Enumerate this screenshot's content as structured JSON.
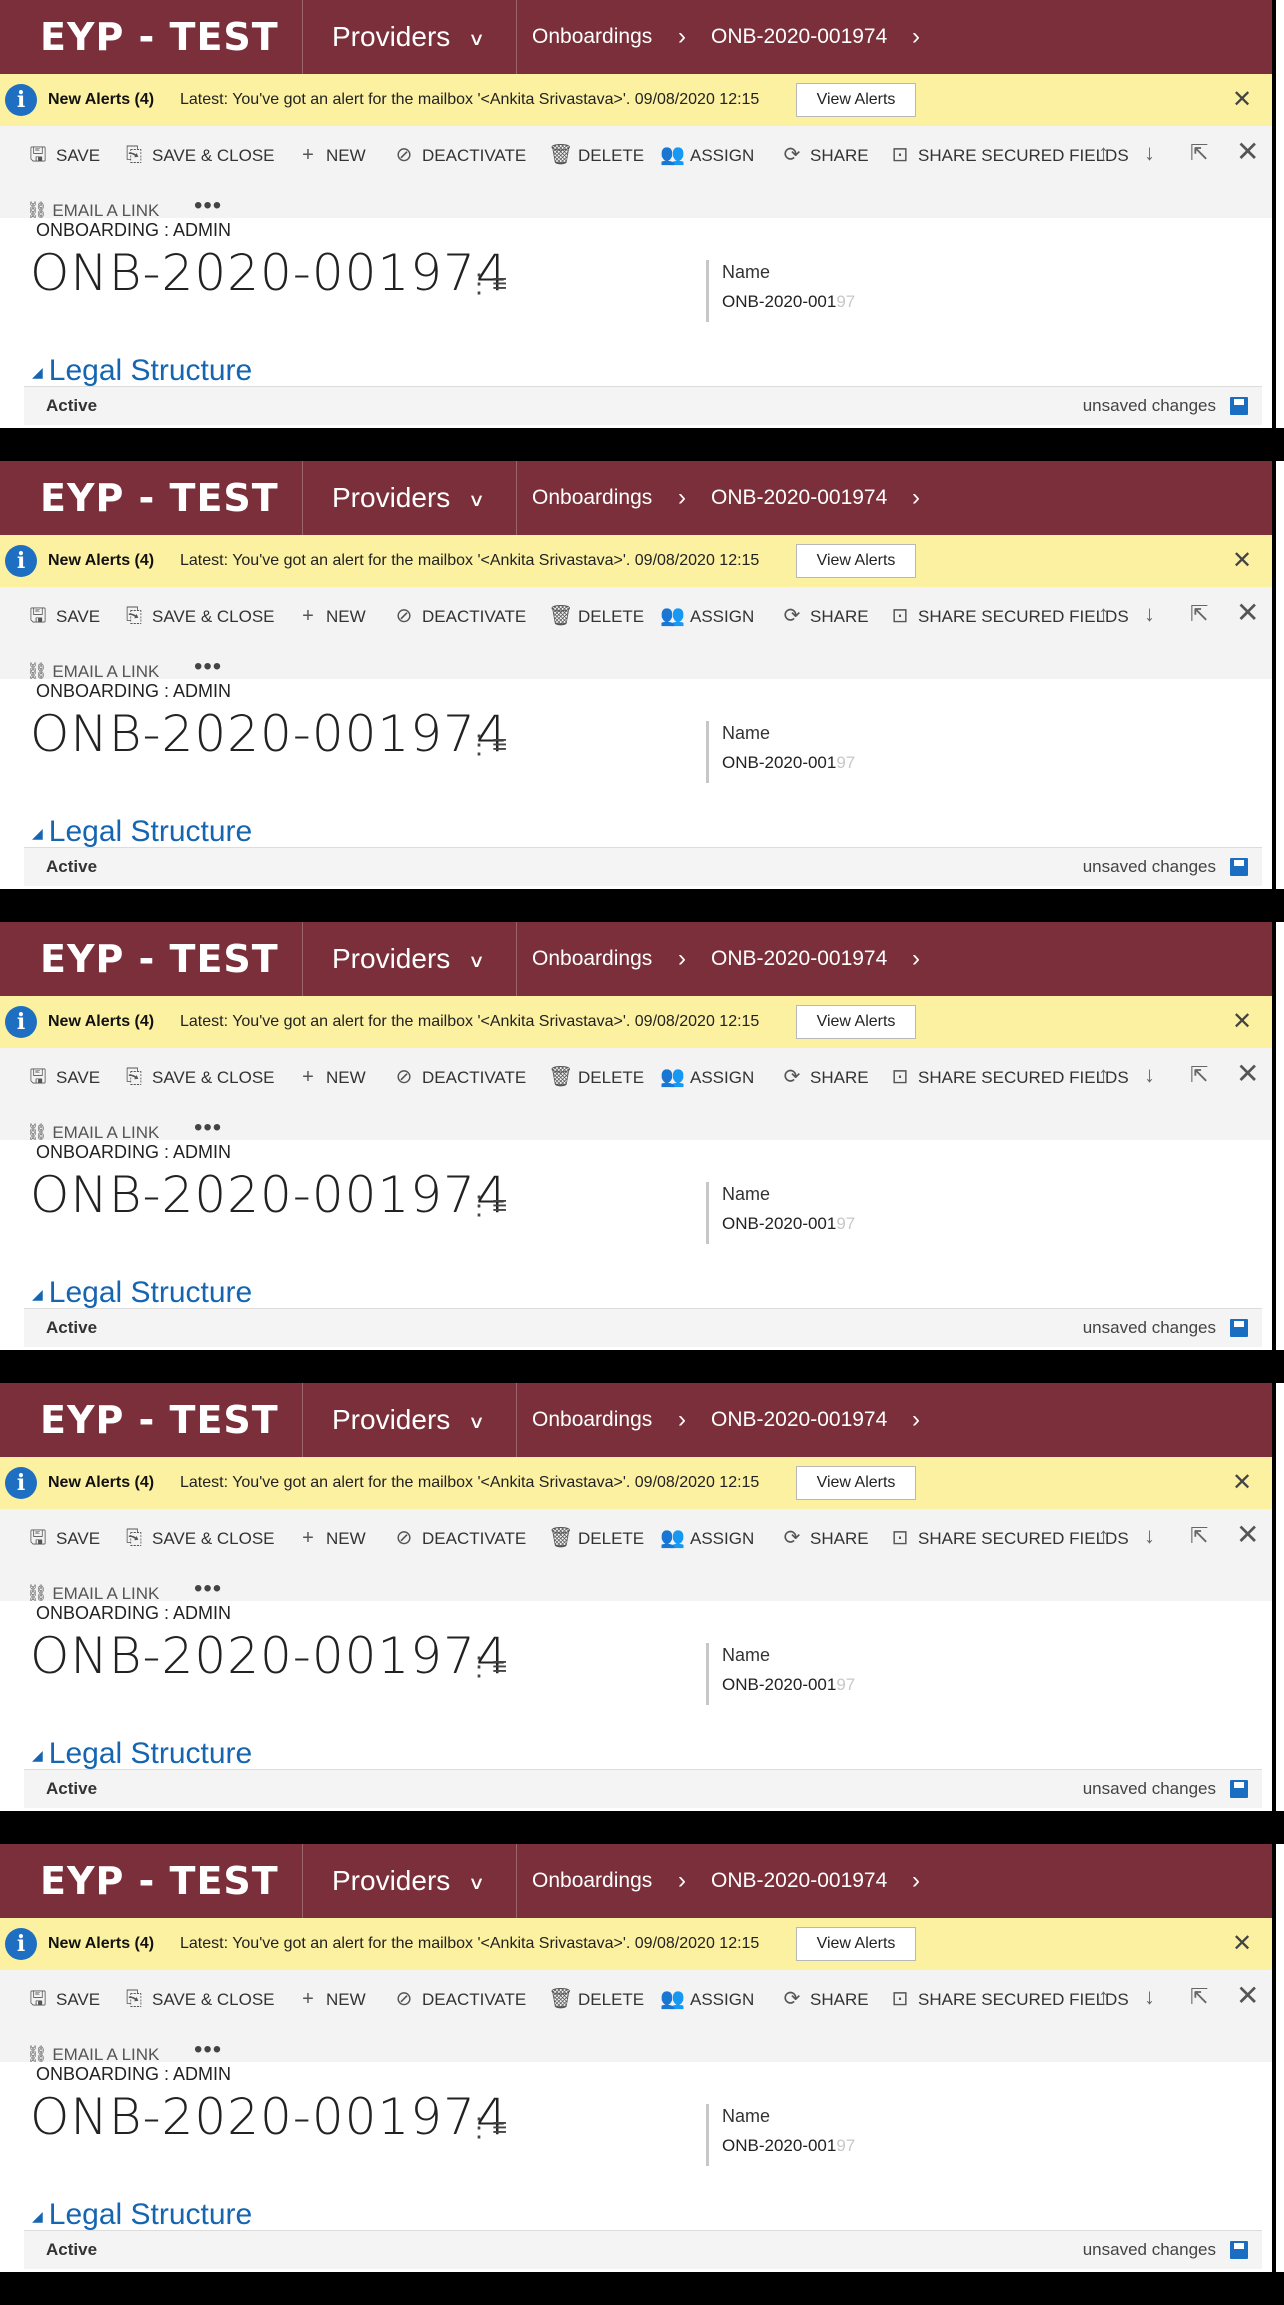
{
  "app": {
    "brand": "EYP - TEST",
    "area": "Providers"
  },
  "breadcrumb": {
    "entity": "Onboardings",
    "record": "ONB-2020-001974"
  },
  "alert": {
    "title": "New Alerts (4)",
    "message": "Latest: You've got an alert for the mailbox '<Ankita Srivastava>'. 09/08/2020 12:15",
    "button": "View Alerts",
    "close": "✕"
  },
  "commands": {
    "save": "SAVE",
    "save_close": "SAVE & CLOSE",
    "new": "NEW",
    "deactivate": "DEACTIVATE",
    "delete": "DELETE",
    "assign": "ASSIGN",
    "share": "SHARE",
    "share_secured": "SHARE SECURED FIELDS",
    "email_link": "EMAIL A LINK",
    "more": "•••"
  },
  "form": {
    "entity_type": "ONBOARDING : ADMIN",
    "record_title": "ONB-2020-001974",
    "name_label": "Name",
    "name_value_visible": "ONB-2020-001",
    "name_value_faded": "97",
    "section": "Legal Structure"
  },
  "footer": {
    "status": "Active",
    "unsaved": "unsaved changes"
  },
  "colors": {
    "nav_bg": "#7a2f3a",
    "alert_bg": "#fbf1a1",
    "info_icon": "#1e6fc2",
    "section_link": "#1565b0"
  },
  "icons": {
    "info": "info-icon",
    "save": "floppy-icon",
    "save_close": "save-close-icon",
    "new": "plus-icon",
    "deactivate": "deactivate-icon",
    "delete": "trash-icon",
    "assign": "people-icon",
    "share": "share-icon",
    "share_secured": "lock-icon",
    "email": "link-icon",
    "up": "arrow-up-icon",
    "down": "arrow-down-icon",
    "popout": "popout-icon",
    "close": "close-icon"
  }
}
